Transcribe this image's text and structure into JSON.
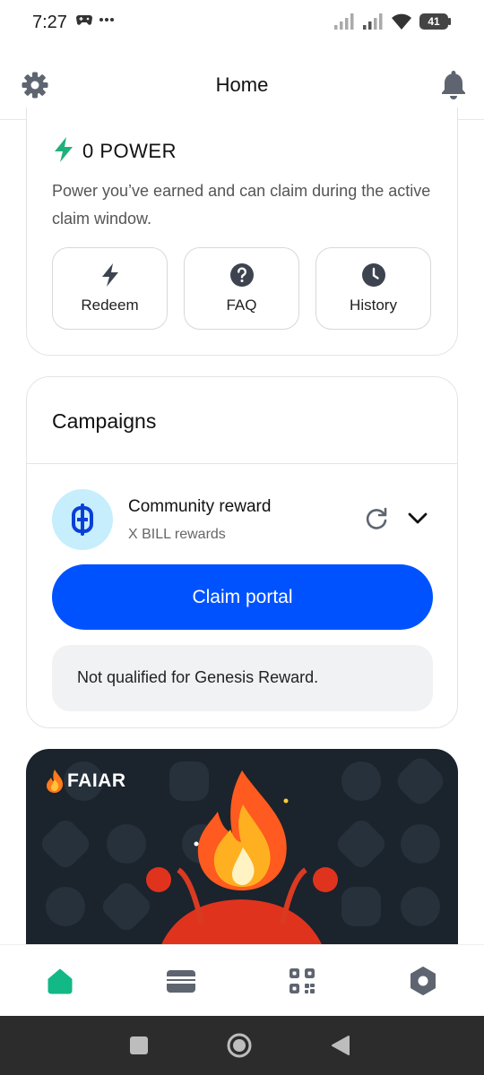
{
  "status_bar": {
    "time": "7:27",
    "battery": "41"
  },
  "header": {
    "title": "Home"
  },
  "power": {
    "title": "0 POWER",
    "description": "Power you’ve earned and can claim during the active claim window.",
    "actions": [
      {
        "label": "Redeem",
        "icon": "bolt-icon"
      },
      {
        "label": "FAQ",
        "icon": "question-icon"
      },
      {
        "label": "History",
        "icon": "clock-icon"
      }
    ]
  },
  "campaigns": {
    "title": "Campaigns",
    "reward": {
      "name": "Community reward",
      "subtitle": "X BILL rewards",
      "coin_letter": "B"
    },
    "claim_label": "Claim portal",
    "notice": "Not qualified for Genesis Reward."
  },
  "banner": {
    "logo_text": "FAIAR"
  },
  "bottom_nav": {
    "items": [
      {
        "name": "home",
        "active": true
      },
      {
        "name": "wallet",
        "active": false
      },
      {
        "name": "qr-scan",
        "active": false
      },
      {
        "name": "settings",
        "active": false
      }
    ]
  },
  "colors": {
    "accent": "#0052ff",
    "power_green": "#1fb07a",
    "nav_active": "#12b886",
    "icon_gray": "#6b7380"
  }
}
